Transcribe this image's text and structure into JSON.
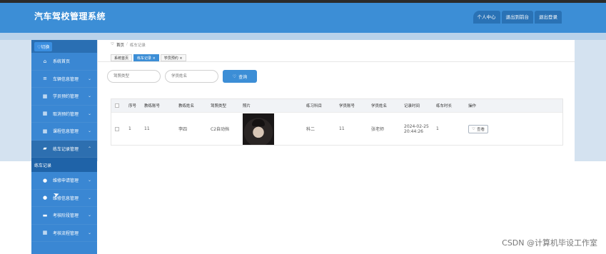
{
  "app": {
    "title": "汽车驾校管理系统"
  },
  "header": {
    "buttons": [
      "个人中心",
      "退出到前台",
      "退出登录"
    ]
  },
  "sidebar": {
    "toggle": "♡切换",
    "items": [
      {
        "label": "系统首页",
        "icon": "home-icon"
      },
      {
        "label": "车辆信息管理",
        "icon": "sliders-icon"
      },
      {
        "label": "学员预约管理",
        "icon": "grid-icon"
      },
      {
        "label": "取消预约管理",
        "icon": "grid-icon"
      },
      {
        "label": "课程信息管理",
        "icon": "grid-icon"
      },
      {
        "label": "练车记录管理",
        "icon": "car-icon"
      },
      {
        "label": "维修申请管理",
        "icon": "user-icon"
      },
      {
        "label": "维修信息管理",
        "icon": "bulb-icon"
      },
      {
        "label": "考核阶段管理",
        "icon": "monitor-icon"
      },
      {
        "label": "考核流程管理",
        "icon": "grid-icon"
      }
    ],
    "sub_item": "练车记录"
  },
  "breadcrumb": {
    "home": "首页",
    "current": "练车记录"
  },
  "tabs": [
    "系统首页",
    "练车记录 ×",
    "学员预约 ×"
  ],
  "search": {
    "field1_placeholder": "驾照类型",
    "field2_placeholder": "学员姓名",
    "button": "查询"
  },
  "table": {
    "headers": [
      "",
      "序号",
      "教练账号",
      "教练姓名",
      "驾照类型",
      "照片",
      "练习科目",
      "学员账号",
      "学员姓名",
      "记录时间",
      "练车时长",
      "操作"
    ],
    "rows": [
      {
        "index": "1",
        "coach_account": "11",
        "coach_name": "李四",
        "license_type": "C2自动挡",
        "subject": "科二",
        "student_account": "11",
        "student_name": "张老师",
        "time_date": "2024-02-25",
        "time_clock": "20:44:26",
        "duration": "1",
        "action": "查看"
      }
    ]
  },
  "watermark": "CSDN @计算机毕设工作室"
}
